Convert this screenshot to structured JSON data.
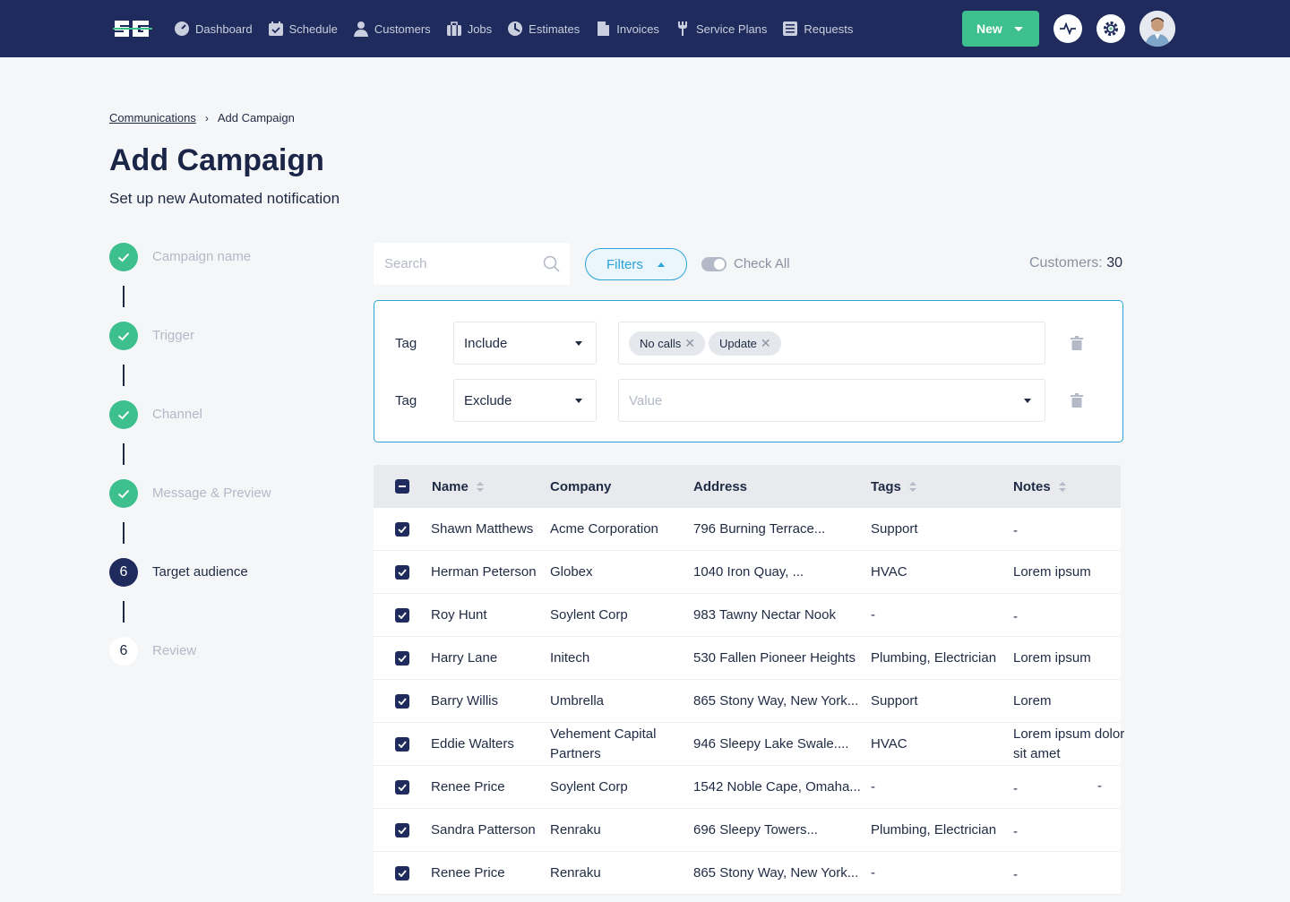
{
  "nav": [
    {
      "label": "Dashboard",
      "icon": "dashboard-icon"
    },
    {
      "label": "Schedule",
      "icon": "calendar-icon"
    },
    {
      "label": "Customers",
      "icon": "user-icon"
    },
    {
      "label": "Jobs",
      "icon": "briefcase-icon"
    },
    {
      "label": "Estimates",
      "icon": "estimate-icon"
    },
    {
      "label": "Invoices",
      "icon": "invoice-icon"
    },
    {
      "label": "Service Plans",
      "icon": "wrench-icon"
    },
    {
      "label": "Requests",
      "icon": "list-icon"
    }
  ],
  "header": {
    "new_label": "New"
  },
  "breadcrumb": {
    "parent": "Communications",
    "current": "Add Campaign"
  },
  "page": {
    "title": "Add Campaign",
    "subtitle": "Set up new Automated notification"
  },
  "steps": [
    {
      "label": "Campaign name",
      "state": "done"
    },
    {
      "label": "Trigger",
      "state": "done"
    },
    {
      "label": "Channel",
      "state": "done"
    },
    {
      "label": "Message & Preview",
      "state": "done"
    },
    {
      "label": "Target audience",
      "state": "active",
      "number": "6"
    },
    {
      "label": "Review",
      "state": "todo",
      "number": "6"
    }
  ],
  "toolbar": {
    "search_placeholder": "Search",
    "filters_label": "Filters",
    "check_all_label": "Check All",
    "customers_label": "Customers:",
    "customers_count": "30"
  },
  "filters": [
    {
      "field": "Tag",
      "operator": "Include",
      "chips": [
        "No calls",
        "Update"
      ],
      "placeholder": ""
    },
    {
      "field": "Tag",
      "operator": "Exclude",
      "chips": [],
      "placeholder": "Value"
    }
  ],
  "table": {
    "columns": [
      "Name",
      "Company",
      "Address",
      "Tags",
      "Notes"
    ],
    "rows": [
      {
        "name": "Shawn Matthews",
        "company": "Acme Corporation",
        "address": "796 Burning Terrace...",
        "tags": "Support",
        "notes": "-"
      },
      {
        "name": "Herman Peterson",
        "company": "Globex",
        "address": "1040 Iron Quay, ...",
        "tags": "HVAC",
        "notes": "Lorem ipsum"
      },
      {
        "name": "Roy Hunt",
        "company": "Soylent Corp",
        "address": "983 Tawny Nectar Nook",
        "tags": "-",
        "notes": "-"
      },
      {
        "name": "Harry Lane",
        "company": "Initech",
        "address": "530 Fallen Pioneer Heights",
        "tags": "Plumbing, Electrician",
        "notes": "Lorem ipsum"
      },
      {
        "name": "Barry Willis",
        "company": "Umbrella",
        "address": "865 Stony Way, New York...",
        "tags": "Support",
        "notes": "Lorem"
      },
      {
        "name": "Eddie Walters",
        "company": "Vehement Capital Partners",
        "address": "946 Sleepy Lake Swale....",
        "tags": "HVAC",
        "notes": "Lorem ipsum dolor sit amet"
      },
      {
        "name": "Renee Price",
        "company": "Soylent Corp",
        "address": "1542 Noble Cape, Omaha...",
        "tags": "-",
        "notes": "-",
        "extra": "-"
      },
      {
        "name": "Sandra Patterson",
        "company": "Renraku",
        "address": "696 Sleepy Towers...",
        "tags": "Plumbing, Electrician",
        "notes": "-"
      },
      {
        "name": "Renee Price",
        "company": "Renraku",
        "address": "865 Stony Way, New York...",
        "tags": "-",
        "notes": "-"
      }
    ]
  },
  "colors": {
    "navy": "#1f2b5c",
    "green": "#3dbf8e",
    "blue": "#2aa3d6"
  }
}
